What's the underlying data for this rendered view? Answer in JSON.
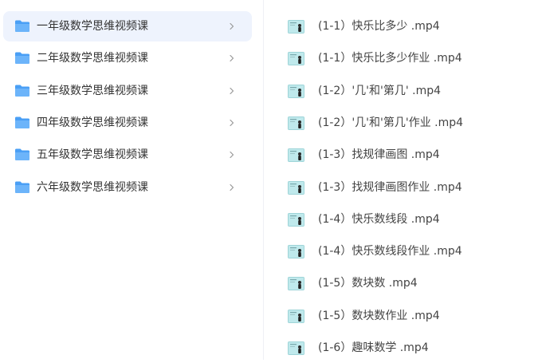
{
  "folders": [
    {
      "label": "一年级数学思维视频课",
      "selected": true
    },
    {
      "label": "二年级数学思维视频课",
      "selected": false
    },
    {
      "label": "三年级数学思维视频课",
      "selected": false
    },
    {
      "label": "四年级数学思维视频课",
      "selected": false
    },
    {
      "label": "五年级数学思维视频课",
      "selected": false
    },
    {
      "label": "六年级数学思维视频课",
      "selected": false
    }
  ],
  "files": [
    {
      "name": "(1-1）快乐比多少 .mp4",
      "thumbnail": "video-thumbnail"
    },
    {
      "name": "(1-1）快乐比多少作业 .mp4",
      "thumbnail": "video-thumbnail"
    },
    {
      "name": "(1-2）'几'和'第几' .mp4",
      "thumbnail": "video-thumbnail"
    },
    {
      "name": "(1-2）'几'和'第几'作业 .mp4",
      "thumbnail": "video-thumbnail"
    },
    {
      "name": "(1-3）找规律画图 .mp4",
      "thumbnail": "video-thumbnail"
    },
    {
      "name": "(1-3）找规律画图作业 .mp4",
      "thumbnail": "video-thumbnail"
    },
    {
      "name": "(1-4）快乐数线段 .mp4",
      "thumbnail": "video-thumbnail"
    },
    {
      "name": "(1-4）快乐数线段作业 .mp4",
      "thumbnail": "video-thumbnail"
    },
    {
      "name": "(1-5）数块数 .mp4",
      "thumbnail": "video-thumbnail"
    },
    {
      "name": "(1-5）数块数作业 .mp4",
      "thumbnail": "video-thumbnail"
    },
    {
      "name": "(1-6）趣味数学 .mp4",
      "thumbnail": "video-thumbnail"
    }
  ],
  "icons": {
    "folder": "folder-icon",
    "chevron": "chevron-right-icon"
  },
  "colors": {
    "selected_bg": "#eef3fd",
    "folder_blue": "#4a9ff5",
    "thumb_teal": "#bfe9ec",
    "chevron": "#999999"
  }
}
